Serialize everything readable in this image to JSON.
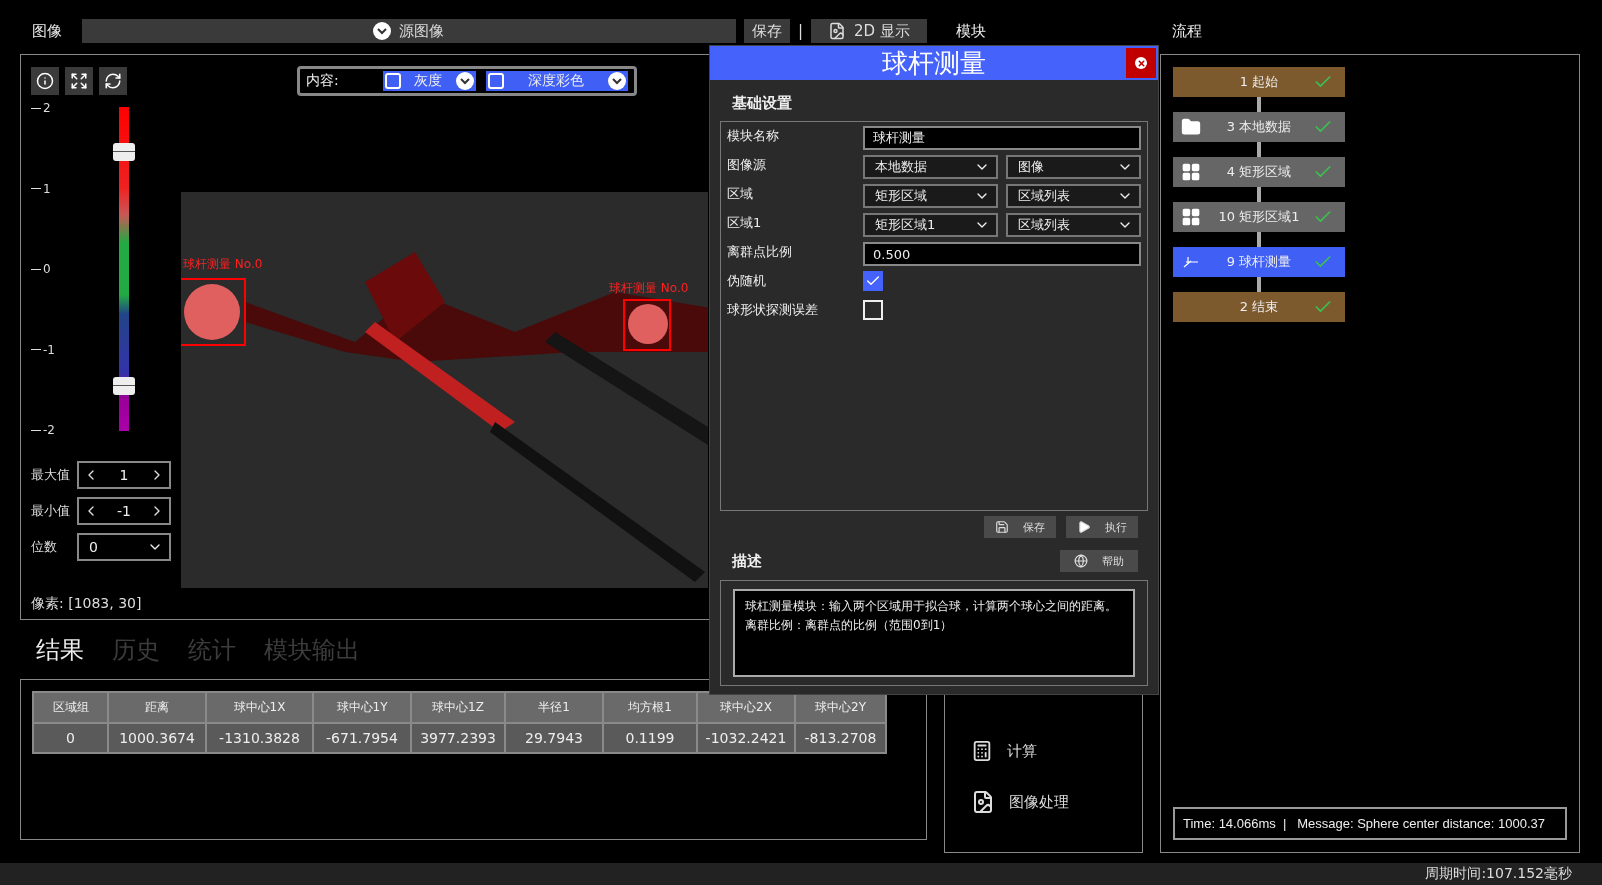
{
  "image_header": {
    "label": "图像",
    "source": "源图像",
    "save": "保存",
    "separator": "|",
    "display": "2D 显示"
  },
  "viewer": {
    "content_label": "内容:",
    "layers": [
      {
        "label": "灰度",
        "checked": false
      },
      {
        "label": "深度彩色",
        "checked": false
      }
    ],
    "scale_ticks": [
      "2",
      "1",
      "0",
      "-1",
      "-2"
    ],
    "range_upper": {
      "level": 0.86
    },
    "range_lower": {
      "level": 0.14
    },
    "max": {
      "label": "最大值",
      "value": "1"
    },
    "min": {
      "label": "最小值",
      "value": "-1"
    },
    "digits": {
      "label": "位数",
      "value": "0"
    },
    "overlays": [
      {
        "label": "球杆测量 No.0"
      },
      {
        "label": "球杆测量 No.0"
      }
    ],
    "pixel": "像素: [1083, 30]"
  },
  "result_tabs": [
    {
      "label": "结果",
      "selected": true
    },
    {
      "label": "历史",
      "selected": false
    },
    {
      "label": "统计",
      "selected": false
    },
    {
      "label": "模块输出",
      "selected": false
    }
  ],
  "table": {
    "columns": [
      "区域组",
      "距离",
      "球中心1X",
      "球中心1Y",
      "球中心1Z",
      "半径1",
      "均方根1",
      "球中心2X",
      "球中心2Y"
    ],
    "rows": [
      [
        "0",
        "1000.3674",
        "-1310.3828",
        "-671.7954",
        "3977.2393",
        "29.7943",
        "0.1199",
        "-1032.2421",
        "-813.2708"
      ]
    ]
  },
  "modules": {
    "title": "模块",
    "items": [
      {
        "label": "计算",
        "kind": "calculator"
      },
      {
        "label": "图像处理",
        "kind": "image"
      }
    ]
  },
  "flow": {
    "title": "流程",
    "nodes": [
      {
        "label": "1 起始",
        "kind": "terminal",
        "selected": false,
        "done": true
      },
      {
        "label": "3 本地数据",
        "kind": "data",
        "selected": false,
        "done": true
      },
      {
        "label": "4 矩形区域",
        "kind": "region",
        "selected": false,
        "done": true
      },
      {
        "label": "10 矩形区域1",
        "kind": "region",
        "selected": false,
        "done": true
      },
      {
        "label": "9 球杆测量",
        "kind": "measure",
        "selected": true,
        "done": true
      },
      {
        "label": "2 结束",
        "kind": "terminal",
        "selected": false,
        "done": true
      }
    ],
    "message": "Time: 14.066ms  |   Message: Sphere center distance: 1000.37"
  },
  "dialog": {
    "title": "球杆测量",
    "section": "基础设置",
    "fields": [
      {
        "kind": "text",
        "label": "模块名称",
        "value": "球杆测量"
      },
      {
        "kind": "select2",
        "label": "图像源",
        "values": [
          "本地数据",
          "图像"
        ]
      },
      {
        "kind": "select2",
        "label": "区域",
        "values": [
          "矩形区域",
          "区域列表"
        ]
      },
      {
        "kind": "select2",
        "label": "区域1",
        "values": [
          "矩形区域1",
          "区域列表"
        ]
      },
      {
        "kind": "text",
        "label": "离群点比例",
        "value": "0.500"
      },
      {
        "kind": "checkbox",
        "label": "伪随机",
        "checked": true
      },
      {
        "kind": "checkbox",
        "label": "球形状探测误差",
        "checked": false
      }
    ],
    "save": "保存",
    "run": "执行",
    "desc_title": "描述",
    "help": "帮助",
    "description": [
      "球杠测量模块：输入两个区域用于拟合球，计算两个球心之间的距离。",
      "离群比例：离群点的比例（范围0到1）"
    ]
  },
  "status": "周期时间:107.152毫秒"
}
